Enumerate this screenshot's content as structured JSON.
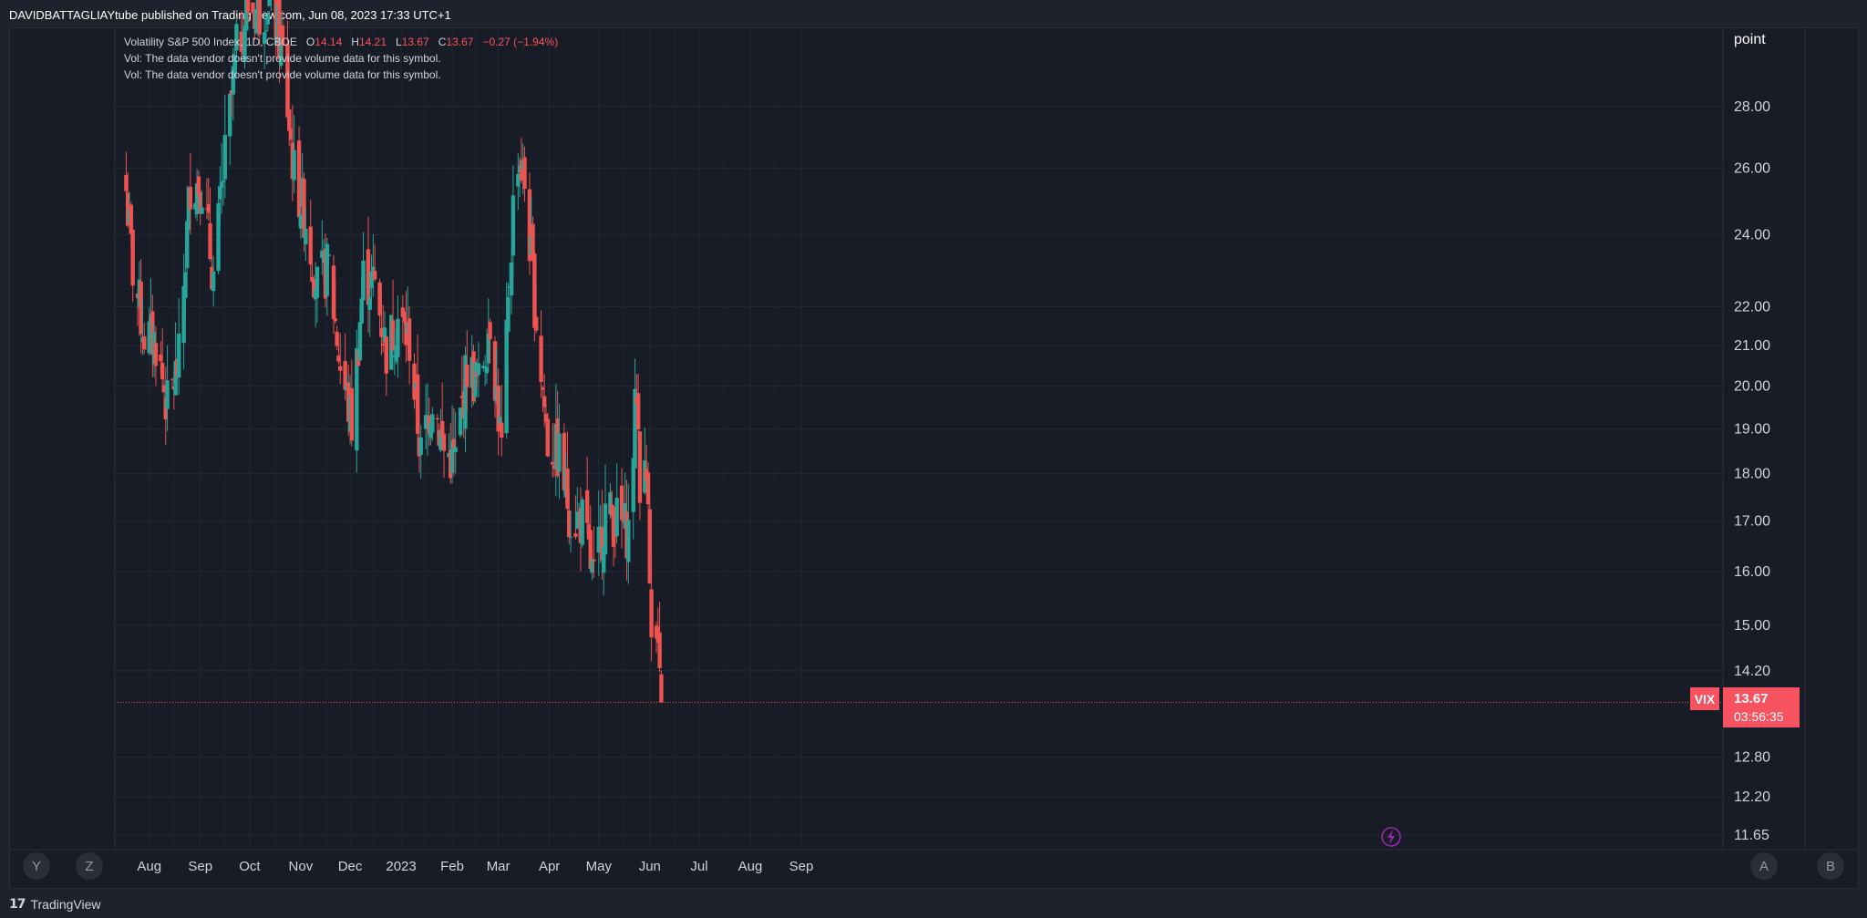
{
  "header": {
    "published_text": "DAVIDBATTAGLIAYtube published on TradingView.com, Jun 08, 2023 17:33 UTC+1"
  },
  "legend": {
    "symbol_title": "Volatility S&P 500 Index, 1D, CBOE",
    "o_label": "O",
    "o_value": "14.14",
    "h_label": "H",
    "h_value": "14.21",
    "l_label": "L",
    "l_value": "13.67",
    "c_label": "C",
    "c_value": "13.67",
    "change": "−0.27 (−1.94%)",
    "vol_line_1": "Vol: The data vendor doesn't provide volume data for this symbol.",
    "vol_line_2": "Vol: The data vendor doesn't provide volume data for this symbol."
  },
  "price_axis": {
    "unit_label": "point"
  },
  "last_price": {
    "symbol": "VIX",
    "price": "13.67",
    "countdown": "03:56:35"
  },
  "axis_buttons": {
    "y": "Y",
    "z": "Z",
    "a": "A",
    "b": "B"
  },
  "footer": {
    "brand_logo": "𝟭𝟳",
    "brand_name": "TradingView"
  },
  "colors": {
    "up": "#26a69a",
    "down": "#ef5350",
    "background": "#181c27",
    "grid": "#242834",
    "last_price_line": "#f7525f",
    "flash_icon": "#9c27b0"
  },
  "chart_data": {
    "type": "candlestick",
    "symbol": "VIX",
    "title": "Volatility S&P 500 Index, 1D, CBOE",
    "ylabel": "point",
    "y_scale": "log",
    "ylim": [
      11.45,
      30.8
    ],
    "y_ticks": [
      "28.00",
      "26.00",
      "24.00",
      "22.00",
      "21.00",
      "20.00",
      "19.00",
      "18.00",
      "17.00",
      "16.00",
      "15.00",
      "14.20",
      "12.80",
      "12.20",
      "11.65"
    ],
    "x_ticks": [
      "Aug",
      "Sep",
      "Oct",
      "Nov",
      "Dec",
      "2023",
      "Feb",
      "Mar",
      "Apr",
      "May",
      "Jun",
      "Jul",
      "Aug",
      "Sep"
    ],
    "last_close": 13.67,
    "close_path": [
      [
        "2022-07-18",
        25.3
      ],
      [
        "2022-07-22",
        23.0
      ],
      [
        "2022-07-29",
        21.3
      ],
      [
        "2022-08-05",
        21.1
      ],
      [
        "2022-08-12",
        19.5
      ],
      [
        "2022-08-19",
        20.6
      ],
      [
        "2022-08-26",
        25.6
      ],
      [
        "2022-09-02",
        25.5
      ],
      [
        "2022-09-09",
        22.8
      ],
      [
        "2022-09-16",
        26.3
      ],
      [
        "2022-09-23",
        29.9
      ],
      [
        "2022-09-30",
        31.6
      ],
      [
        "2022-10-07",
        31.4
      ],
      [
        "2022-10-14",
        32.0
      ],
      [
        "2022-10-21",
        29.7
      ],
      [
        "2022-10-28",
        25.8
      ],
      [
        "2022-11-04",
        24.5
      ],
      [
        "2022-11-11",
        22.5
      ],
      [
        "2022-11-18",
        23.1
      ],
      [
        "2022-11-25",
        20.5
      ],
      [
        "2022-12-02",
        19.1
      ],
      [
        "2022-12-09",
        22.8
      ],
      [
        "2022-12-16",
        22.6
      ],
      [
        "2022-12-23",
        20.9
      ],
      [
        "2022-12-30",
        21.7
      ],
      [
        "2023-01-06",
        21.1
      ],
      [
        "2023-01-13",
        18.4
      ],
      [
        "2023-01-20",
        19.8
      ],
      [
        "2023-01-27",
        18.5
      ],
      [
        "2023-02-03",
        18.3
      ],
      [
        "2023-02-10",
        20.5
      ],
      [
        "2023-02-17",
        20.0
      ],
      [
        "2023-02-24",
        21.7
      ],
      [
        "2023-03-03",
        18.5
      ],
      [
        "2023-03-10",
        24.8
      ],
      [
        "2023-03-13",
        26.5
      ],
      [
        "2023-03-17",
        25.5
      ],
      [
        "2023-03-24",
        21.7
      ],
      [
        "2023-03-31",
        18.7
      ],
      [
        "2023-04-07",
        18.4
      ],
      [
        "2023-04-14",
        17.1
      ],
      [
        "2023-04-21",
        17.0
      ],
      [
        "2023-04-28",
        15.8
      ],
      [
        "2023-05-05",
        17.2
      ],
      [
        "2023-05-12",
        17.0
      ],
      [
        "2023-05-19",
        16.8
      ],
      [
        "2023-05-24",
        20.0
      ],
      [
        "2023-05-26",
        17.9
      ],
      [
        "2023-05-31",
        17.9
      ],
      [
        "2023-06-02",
        14.6
      ],
      [
        "2023-06-05",
        14.7
      ],
      [
        "2023-06-07",
        13.9
      ],
      [
        "2023-06-08",
        13.67
      ]
    ]
  }
}
